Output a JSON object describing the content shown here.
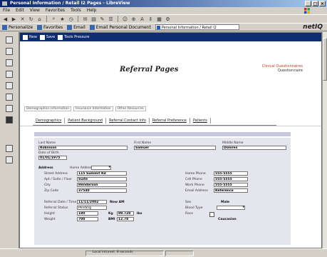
{
  "window": {
    "title": "Personal Information / Retail I2 Pages - LibreView",
    "min": "_",
    "max": "□",
    "close": "×"
  },
  "menu": [
    "File",
    "Edit",
    "View",
    "Favorites",
    "Tools",
    "Help"
  ],
  "toolbar_icons": [
    "back-icon",
    "forward-icon",
    "stop-icon",
    "refresh-icon",
    "home-icon",
    "search-icon",
    "favorites-icon",
    "history-icon",
    "mail-icon",
    "print-icon",
    "edit-icon",
    "discuss-icon",
    "messenger-icon",
    "zoom-icon",
    "font-icon",
    "size-icon",
    "layout-icon",
    "options-icon"
  ],
  "linksbar": {
    "items": [
      "Personalize",
      "Favorites",
      "Email",
      "Email Personal Document"
    ],
    "address": "Personal Information / Retail I2",
    "brand": "netIQ"
  },
  "header_buttons": [
    "New",
    "Save",
    "Tools Pressure"
  ],
  "page": {
    "title": "Referral Pages",
    "topright": "Clinical Questionnaires",
    "topright_sub": "Questionnaire"
  },
  "crumbs": [
    "Demographics Information",
    "Insurance Information",
    "Other Resources"
  ],
  "tabs": [
    "Demographics",
    "Patient Background",
    "Referral Contact Info",
    "Referral Preference",
    "Patients"
  ],
  "form": {
    "row1_labels": [
      "Last Name",
      "First Name",
      "Middle Name"
    ],
    "row1_values": [
      "Robinson",
      "Samuel",
      "Dolores"
    ],
    "dob_label": "Date of Birth",
    "dob_value": "01/01/1975",
    "address": {
      "section": "Address",
      "type_label": "Home Address",
      "street_label": "Street Address",
      "street_value": "115 Summit Rd",
      "line2_label": "Apt / Suite / Floor",
      "line2_value": "Suite",
      "city_label": "City",
      "city_value": "Henderson",
      "zip_label": "Zip Code",
      "zip_value": "37540"
    },
    "contact": {
      "home_label": "Home Phone",
      "home_value": "555-5555",
      "cell_label": "Cell Phone",
      "cell_value": "555-5555",
      "work_label": "Work Phone",
      "work_value": "555-5555",
      "email_label": "Email Address",
      "email_value": "Reference"
    },
    "extra": {
      "ref_date_label": "Referral Date / Time",
      "ref_date_value": "11/11/2002",
      "ref_time": "Now  AM",
      "status_label": "Referral Status",
      "status_value": "Pending",
      "height_label": "Height",
      "height_value": "180",
      "weight_label": "Weight",
      "weight_value": "700",
      "wt_unit_a": "Kg",
      "lbs_value": "99.720",
      "lbs_unit": "lbs",
      "bmi_label": "BMI",
      "bmi_value": "12.78",
      "sex_label": "Sex",
      "sex_value": "Male",
      "blood_label": "Blood Type",
      "race_label": "Race",
      "race_value": "Caucasian"
    }
  },
  "status": {
    "text": "Local intranet: 8 seconds"
  }
}
